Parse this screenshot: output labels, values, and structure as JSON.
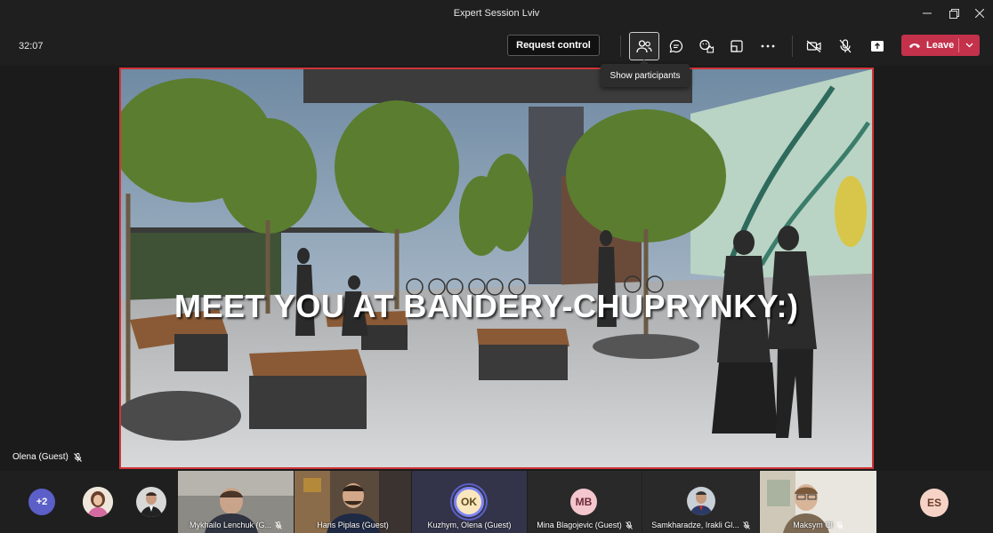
{
  "window": {
    "title": "Expert Session Lviv"
  },
  "toolbar": {
    "timer": "32:07",
    "request_control": "Request control",
    "leave_label": "Leave",
    "tooltip": "Show participants",
    "icons": [
      "participants-icon",
      "chat-icon",
      "reactions-icon",
      "rooms-icon",
      "more-icon",
      "camera-off-icon",
      "mic-off-icon",
      "share-icon",
      "phone-icon"
    ],
    "leave_color": "#c4314b"
  },
  "stage": {
    "caption": "MEET YOU AT BANDERY-CHUPRYNKY:)",
    "presenter": "Olena (Guest)",
    "border_color": "#d13438"
  },
  "participants": {
    "overflow": "+2",
    "tiles": [
      {
        "name": "Mykhailo Lenchuk (G..."
      },
      {
        "name": "Haris Piplas (Guest)"
      },
      {
        "name": "Kuzhym, Olena (Guest)",
        "initials": "OK"
      },
      {
        "name": "Mina Blagojevic (Guest)",
        "initials": "MB"
      },
      {
        "name": "Samkharadze, Irakli Gl..."
      },
      {
        "name": "Maksym Cl"
      }
    ],
    "last_initials": "ES"
  }
}
